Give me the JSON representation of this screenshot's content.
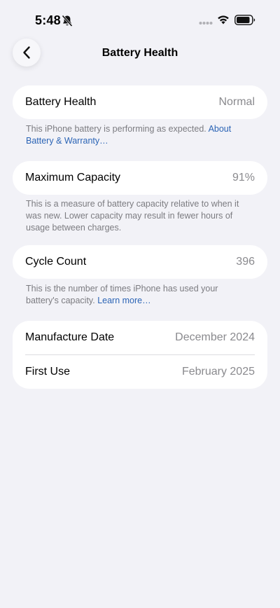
{
  "status": {
    "time": "5:48",
    "icons": [
      "bell-slash-icon",
      "signal-dots-icon",
      "wifi-icon",
      "battery-icon"
    ]
  },
  "nav": {
    "title": "Battery Health",
    "back_icon": "chevron-left-icon"
  },
  "sections": {
    "health": {
      "label": "Battery Health",
      "value": "Normal",
      "note": "This iPhone battery is performing as expected. ",
      "note_link": "About Battery & Warranty…"
    },
    "capacity": {
      "label": "Maximum Capacity",
      "value": "91%",
      "note": "This is a measure of battery capacity relative to when it was new. Lower capacity may result in fewer hours of usage between charges."
    },
    "cycles": {
      "label": "Cycle Count",
      "value": "396",
      "note": "This is the number of times iPhone has used your battery's capacity. ",
      "note_link": "Learn more…"
    },
    "dates": {
      "manufacture_label": "Manufacture Date",
      "manufacture_value": "December 2024",
      "first_use_label": "First Use",
      "first_use_value": "February 2025"
    }
  },
  "colors": {
    "background": "#f2f2f7",
    "link": "#2b64b5",
    "secondary_text": "#8a8a8e"
  }
}
